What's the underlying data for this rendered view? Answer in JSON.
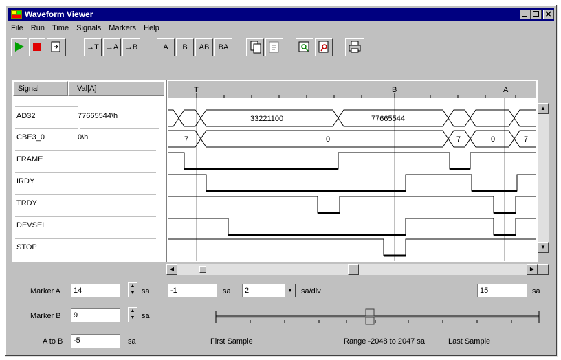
{
  "window": {
    "title": "Waveform Viewer"
  },
  "menu": [
    "File",
    "Run",
    "Time",
    "Signals",
    "Markers",
    "Help"
  ],
  "toolbar": {
    "move_t": "→T",
    "move_a": "→A",
    "move_b": "→B",
    "marker_a": "A",
    "marker_b": "B",
    "marker_ab": "AB",
    "marker_ba": "BA"
  },
  "signals_header": {
    "name": "Signal",
    "value": "Val[A]"
  },
  "signals": [
    {
      "name": "AD32",
      "value": "77665544\\h"
    },
    {
      "name": "CBE3_0",
      "value": "0\\h"
    },
    {
      "name": "FRAME",
      "value": ""
    },
    {
      "name": "IRDY",
      "value": ""
    },
    {
      "name": "TRDY",
      "value": ""
    },
    {
      "name": "DEVSEL",
      "value": ""
    },
    {
      "name": "STOP",
      "value": ""
    }
  ],
  "ruler_markers": {
    "t": "T",
    "b": "B",
    "a": "A"
  },
  "bus_values": {
    "ad32": [
      "33221100",
      "77665544"
    ],
    "cbe": [
      "7",
      "0",
      "7",
      "0",
      "7"
    ]
  },
  "controls": {
    "marker_a_label": "Marker A",
    "marker_a_value": "14",
    "marker_b_label": "Marker B",
    "marker_b_value": "9",
    "a_to_b_label": "A to B",
    "a_to_b_value": "-5",
    "unit_sa": "sa",
    "start_value": "-1",
    "zoom_value": "2",
    "zoom_unit": "sa/div",
    "end_value": "15",
    "first_sample": "First Sample",
    "range": "Range -2048 to 2047 sa",
    "last_sample": "Last Sample"
  }
}
